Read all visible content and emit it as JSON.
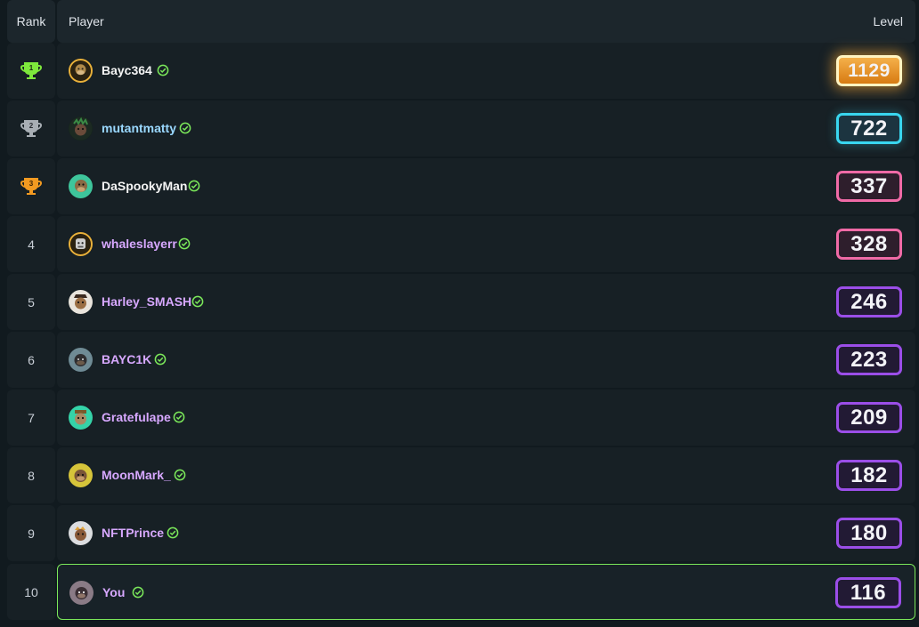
{
  "header": {
    "rank": "Rank",
    "player": "Player",
    "level": "Level"
  },
  "colors": {
    "gold_trophy": "#7ee83c",
    "silver_trophy": "#a8aeb4",
    "bronze_trophy": "#f29a21",
    "verified": "#7be85a",
    "you_border": "#7be85a",
    "name_gold": "#f4f4f4",
    "name_cyan": "#9ad8ff",
    "name_purple": "#d7a8ff"
  },
  "rows": [
    {
      "rank": "1",
      "trophy": "trophy-1-icon",
      "player": "Bayc364",
      "level": "1129",
      "badge": "gold",
      "avatar": "ape-avatar"
    },
    {
      "rank": "2",
      "trophy": "trophy-2-icon",
      "player": "mutantmatty",
      "level": "722",
      "badge": "cyan",
      "avatar": "mutant-ape-avatar"
    },
    {
      "rank": "3",
      "trophy": "trophy-3-icon",
      "player": "DaSpookyMan",
      "level": "337",
      "badge": "pink",
      "avatar": "ape-avatar"
    },
    {
      "rank": "4",
      "player": "whaleslayerr",
      "level": "328",
      "badge": "pink",
      "avatar": "ape-avatar"
    },
    {
      "rank": "5",
      "player": "Harley_SMASH",
      "level": "246",
      "badge": "purple",
      "avatar": "ape-avatar"
    },
    {
      "rank": "6",
      "player": "BAYC1K",
      "level": "223",
      "badge": "purple",
      "avatar": "ape-avatar"
    },
    {
      "rank": "7",
      "player": "Gratefulape",
      "level": "209",
      "badge": "purple",
      "avatar": "ape-avatar"
    },
    {
      "rank": "8",
      "player": "MoonMark_",
      "level": "182",
      "badge": "purple",
      "avatar": "ape-avatar"
    },
    {
      "rank": "9",
      "player": "NFTPrince",
      "level": "180",
      "badge": "purple",
      "avatar": "ape-avatar"
    },
    {
      "rank": "10",
      "player": "You",
      "level": "116",
      "badge": "purple",
      "avatar": "ape-avatar",
      "is_you": true
    }
  ]
}
